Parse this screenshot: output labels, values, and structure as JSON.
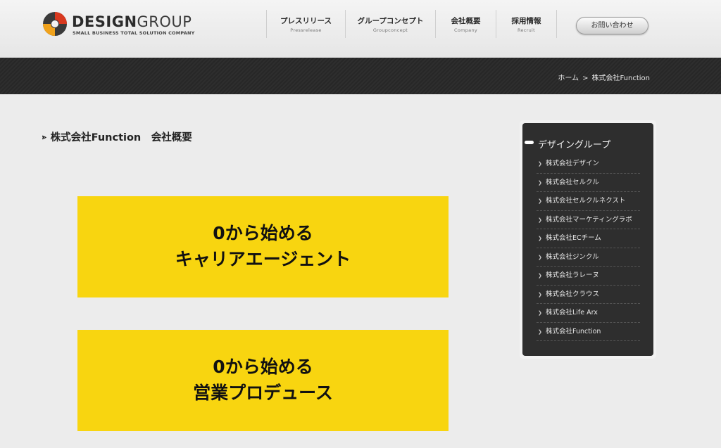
{
  "header": {
    "logo": {
      "main_bold": "DESIGN",
      "main_thin": "GROUP",
      "tagline": "SMALL BUSINESS TOTAL SOLUTION COMPANY"
    },
    "nav": [
      {
        "jp": "プレスリリース",
        "en": "Pressrelease"
      },
      {
        "jp": "グループコンセプト",
        "en": "Groupconcept"
      },
      {
        "jp": "会社概要",
        "en": "Company"
      },
      {
        "jp": "採用情報",
        "en": "Recruit"
      }
    ],
    "contact_label": "お問い合わせ"
  },
  "breadcrumb": {
    "home": "ホーム",
    "separator": ">",
    "current": "株式会社Function"
  },
  "page_title": "株式会社Function　会社概要",
  "banners": [
    {
      "line1": "0から始める",
      "line2": "キャリアエージェント"
    },
    {
      "line1": "0から始める",
      "line2": "営業プロデュース"
    }
  ],
  "sidebar": {
    "title": "デザイングループ",
    "items": [
      "株式会社デザイン",
      "株式会社セルクル",
      "株式会社セルクルネクスト",
      "株式会社マーケティングラボ",
      "株式会社ECチーム",
      "株式会社ジンクル",
      "株式会社ラレーヌ",
      "株式会社クラウス",
      "株式会社Life Arx",
      "株式会社Function"
    ]
  },
  "colors": {
    "banner": "#f8d510",
    "band": "#2c2c2c",
    "sidebar": "#2e2e2e",
    "logo_red": "#d8391f",
    "logo_orange": "#f0a21c"
  },
  "icons": {
    "logo": "design-group-logo-mark",
    "title_arrow": "double-chevron-icon",
    "sidebar_bullet": "chevron-right-icon"
  }
}
